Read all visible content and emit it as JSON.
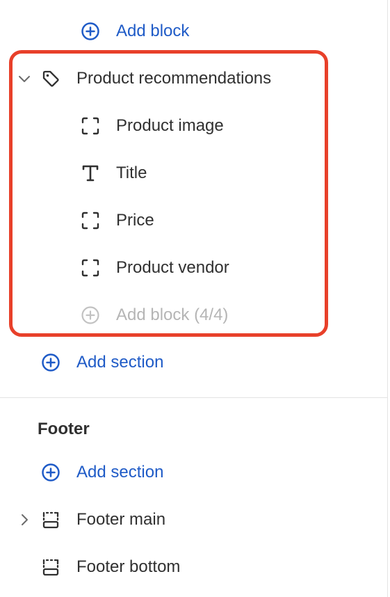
{
  "template": {
    "add_block_label": "Add block",
    "section": {
      "name": "Product recommendations",
      "expanded": true,
      "blocks": [
        {
          "label": "Product image",
          "icon": "image-placeholder-icon"
        },
        {
          "label": "Title",
          "icon": "text-title-icon"
        },
        {
          "label": "Price",
          "icon": "price-placeholder-icon"
        },
        {
          "label": "Product vendor",
          "icon": "vendor-placeholder-icon"
        }
      ],
      "add_block_disabled_label": "Add block (4/4)"
    },
    "add_section_label": "Add section"
  },
  "footer": {
    "title": "Footer",
    "add_section_label": "Add section",
    "sections": [
      {
        "label": "Footer main",
        "icon": "footer-layout-icon",
        "expandable": true
      },
      {
        "label": "Footer bottom",
        "icon": "footer-layout-icon",
        "expandable": false
      }
    ]
  },
  "colors": {
    "link_blue": "#1f5bc7",
    "highlight_red": "#e8402a",
    "disabled_grey": "#b5b5b5",
    "text_dark": "#303030"
  }
}
